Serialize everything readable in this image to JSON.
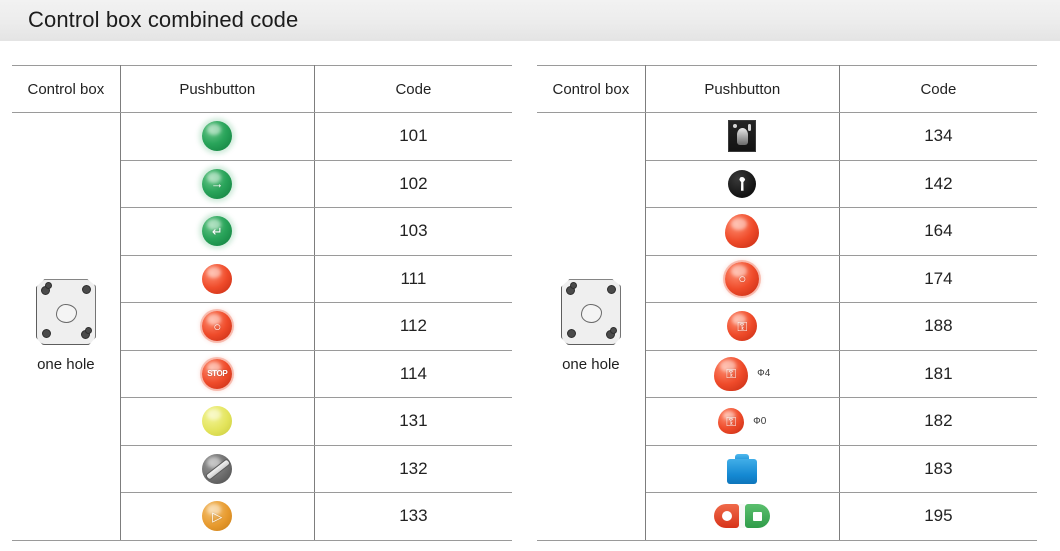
{
  "title": "Control box combined code",
  "headers": {
    "control_box": "Control box",
    "pushbutton": "Pushbutton",
    "code": "Code"
  },
  "colors": {
    "title_band": "#ececec",
    "grid_line": "#9a9a9a",
    "divider": "#7d7d7d",
    "green_button": "#29a45a",
    "red_button": "#ef4b2a",
    "yellow_button": "#e3e45c",
    "amber_button": "#e79a2e",
    "gray_knob": "#6d6d6d",
    "blue_cover": "#1488d2",
    "black_switch": "#131313",
    "enclosure_body": "#efefef"
  },
  "tables": [
    {
      "id": "left",
      "control_box": {
        "label": "one hole",
        "icon": "control-box-one-hole-icon"
      },
      "rows": [
        {
          "icon": "green-flush-pushbutton-icon",
          "glyph": "",
          "dia": "",
          "code": "101"
        },
        {
          "icon": "green-arrow-pushbutton-icon",
          "glyph": "→",
          "dia": "",
          "code": "102"
        },
        {
          "icon": "green-return-arrow-pushbutton-icon",
          "glyph": "↵",
          "dia": "",
          "code": "103"
        },
        {
          "icon": "red-flush-pushbutton-icon",
          "glyph": "",
          "dia": "",
          "code": "111"
        },
        {
          "icon": "red-power-off-pushbutton-icon",
          "glyph": "○",
          "dia": "",
          "code": "112"
        },
        {
          "icon": "red-stop-pushbutton-icon",
          "glyph": "STOP",
          "dia": "",
          "code": "114"
        },
        {
          "icon": "yellow-flush-pushbutton-icon",
          "glyph": "",
          "dia": "",
          "code": "131"
        },
        {
          "icon": "gray-selector-knob-icon",
          "glyph": "",
          "dia": "",
          "code": "132"
        },
        {
          "icon": "amber-selector-pushbutton-icon",
          "glyph": "▷",
          "dia": "",
          "code": "133"
        }
      ]
    },
    {
      "id": "right",
      "control_box": {
        "label": "one hole",
        "icon": "control-box-one-hole-icon"
      },
      "rows": [
        {
          "icon": "dark-selector-switch-plate-icon",
          "glyph": "",
          "dia": "",
          "code": "134"
        },
        {
          "icon": "black-key-switch-icon",
          "glyph": "",
          "dia": "",
          "code": "142"
        },
        {
          "icon": "red-mushroom-head-icon",
          "glyph": "",
          "dia": "",
          "code": "164"
        },
        {
          "icon": "red-mushroom-ring-icon",
          "glyph": "○",
          "dia": "",
          "code": "174"
        },
        {
          "icon": "red-emergency-stop-key-icon",
          "glyph": "⚿",
          "dia": "",
          "code": "188"
        },
        {
          "icon": "red-mushroom-twist-icon",
          "glyph": "⚿",
          "dia": "Ф4",
          "code": "181"
        },
        {
          "icon": "red-mushroom-twist-small-icon",
          "glyph": "⚿",
          "dia": "Ф0",
          "code": "182"
        },
        {
          "icon": "blue-protective-cover-icon",
          "glyph": "",
          "dia": "",
          "code": "183"
        },
        {
          "icon": "red-green-dual-pushbutton-icon",
          "glyph": "",
          "dia": "",
          "code": "195"
        }
      ]
    }
  ]
}
